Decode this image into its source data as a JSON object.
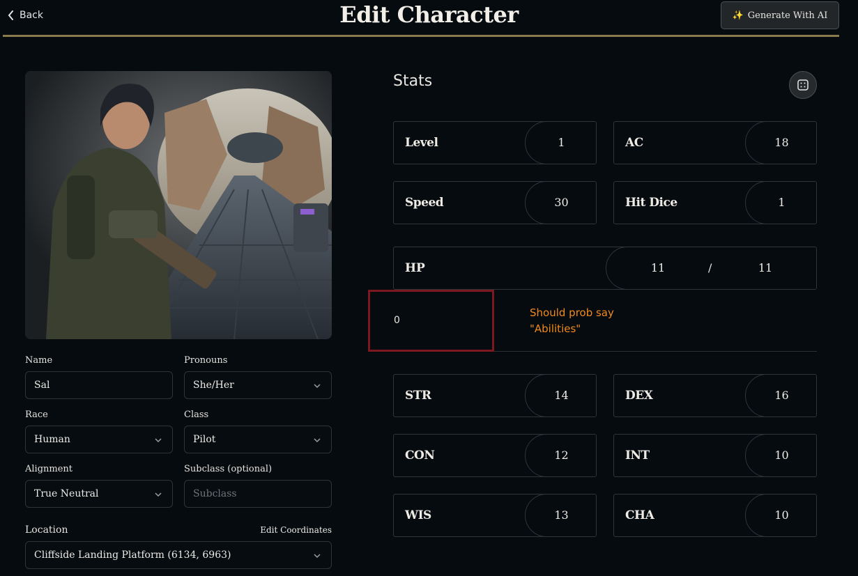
{
  "header": {
    "back_label": "Back",
    "title": "Edit Character",
    "generate_label": "Generate With AI",
    "generate_icon": "sparkles-icon"
  },
  "form": {
    "name_label": "Name",
    "name_value": "Sal",
    "pronouns_label": "Pronouns",
    "pronouns_value": "She/Her",
    "race_label": "Race",
    "race_value": "Human",
    "class_label": "Class",
    "class_value": "Pilot",
    "alignment_label": "Alignment",
    "alignment_value": "True Neutral",
    "subclass_label": "Subclass (optional)",
    "subclass_placeholder": "Subclass",
    "location_label": "Location",
    "edit_coordinates_label": "Edit Coordinates",
    "location_value": "Cliffside Landing Platform (6134, 6963)"
  },
  "stats": {
    "title": "Stats",
    "level_label": "Level",
    "level_value": "1",
    "ac_label": "AC",
    "ac_value": "18",
    "speed_label": "Speed",
    "speed_value": "30",
    "hit_dice_label": "Hit Dice",
    "hit_dice_value": "1",
    "hp_label": "HP",
    "hp_current": "11",
    "hp_separator": "/",
    "hp_max": "11"
  },
  "annotation": {
    "value": "0",
    "note_line1": "Should prob say",
    "note_line2": "\"Abilities\"",
    "box_color": "#7d1720",
    "note_color": "#f08a1c"
  },
  "abilities": {
    "str_label": "STR",
    "str_value": "14",
    "dex_label": "DEX",
    "dex_value": "16",
    "con_label": "CON",
    "con_value": "12",
    "int_label": "INT",
    "int_value": "10",
    "wis_label": "WIS",
    "wis_value": "13",
    "cha_label": "CHA",
    "cha_value": "10"
  },
  "colors": {
    "background": "#060b10",
    "header_rule": "#8b7a4c",
    "border": "#30353a"
  }
}
